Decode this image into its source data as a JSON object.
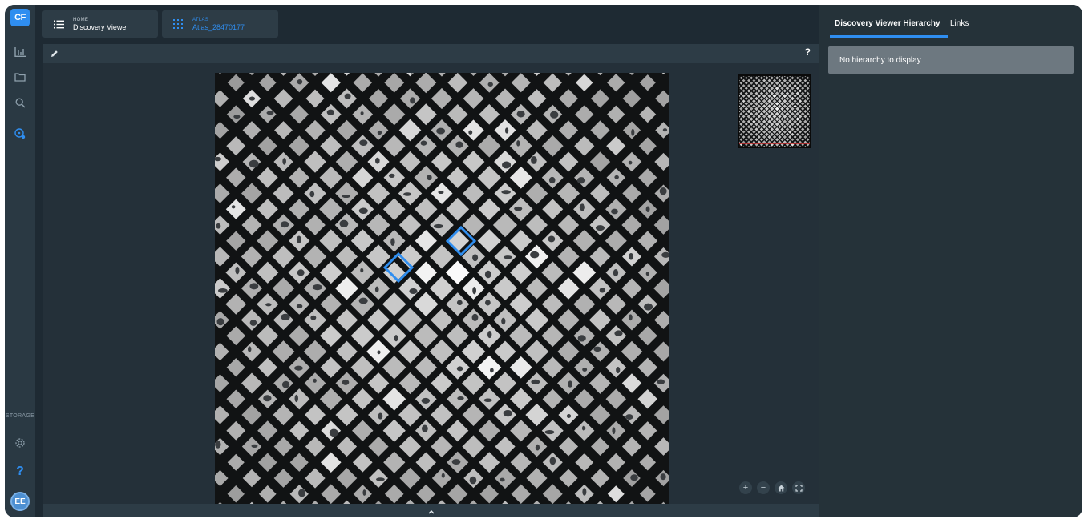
{
  "app": {
    "logo_text": "CF",
    "accent": "#2f8ef0"
  },
  "rail": {
    "items": [
      {
        "icon": "bar-chart-icon"
      },
      {
        "icon": "folder-icon"
      },
      {
        "icon": "search-icon"
      },
      {
        "icon": "discovery-icon"
      }
    ],
    "storage_label": "STORAGE",
    "settings_icon": "gear-icon",
    "help_label": "?",
    "avatar_initials": "EE"
  },
  "tabs": [
    {
      "kicker": "HOME",
      "title": "Discovery Viewer",
      "icon": "list-icon"
    },
    {
      "kicker": "ATLAS",
      "title": "Atlas_28470177",
      "icon": "grid-icon"
    }
  ],
  "toolbar": {
    "edit_icon": "pencil-icon",
    "help_label": "?"
  },
  "viewer": {
    "zoom_in_label": "+",
    "zoom_out_label": "−",
    "home_icon": "home-icon",
    "fullscreen_icon": "fullscreen-icon",
    "collapse_icon": "chevron-up-icon",
    "highlight_color": "#2f8ef0"
  },
  "right_panel": {
    "tabs": [
      "Discovery Viewer Hierarchy",
      "Links"
    ],
    "active_tab": "Discovery Viewer Hierarchy",
    "empty_message": "No hierarchy to display"
  }
}
